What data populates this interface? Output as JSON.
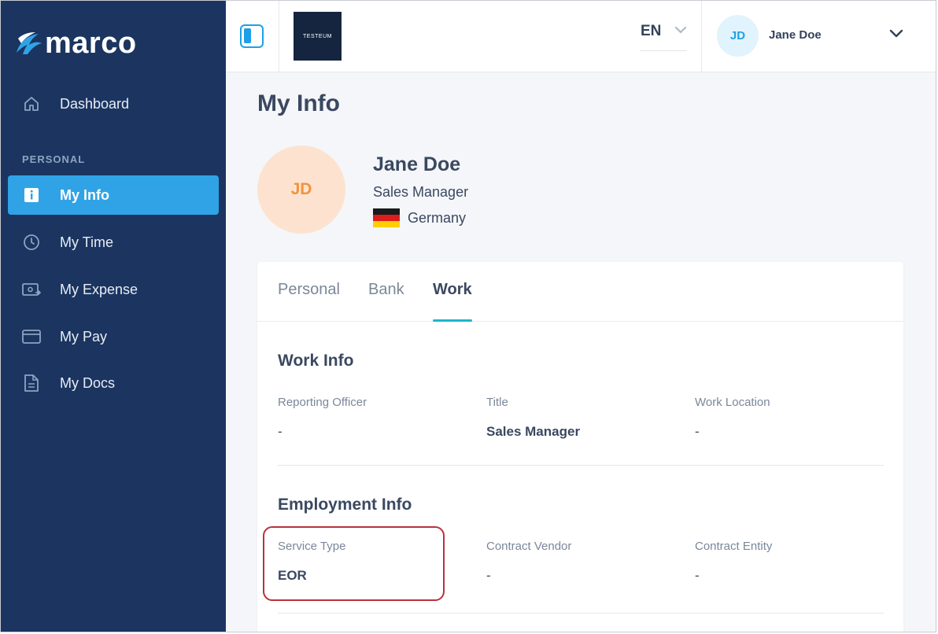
{
  "brand": {
    "name": "marco"
  },
  "sidebar": {
    "dashboard_label": "Dashboard",
    "section_label": "PERSONAL",
    "items": [
      {
        "label": "My Info",
        "icon": "info-icon",
        "active": true
      },
      {
        "label": "My Time",
        "icon": "clock-icon",
        "active": false
      },
      {
        "label": "My Expense",
        "icon": "expense-icon",
        "active": false
      },
      {
        "label": "My Pay",
        "icon": "card-icon",
        "active": false
      },
      {
        "label": "My Docs",
        "icon": "document-icon",
        "active": false
      }
    ]
  },
  "topbar": {
    "company_logo_text": "TESTEUM",
    "language": "EN",
    "user": {
      "initials": "JD",
      "name": "Jane Doe"
    }
  },
  "page": {
    "title": "My Info"
  },
  "profile": {
    "initials": "JD",
    "name": "Jane Doe",
    "job_title": "Sales Manager",
    "country": "Germany"
  },
  "tabs": [
    "Personal",
    "Bank",
    "Work"
  ],
  "active_tab": "Work",
  "work_info": {
    "title": "Work Info",
    "fields": [
      {
        "label": "Reporting Officer",
        "value": "-"
      },
      {
        "label": "Title",
        "value": "Sales Manager"
      },
      {
        "label": "Work Location",
        "value": "-"
      }
    ]
  },
  "employment_info": {
    "title": "Employment Info",
    "fields": [
      {
        "label": "Service Type",
        "value": "EOR"
      },
      {
        "label": "Contract Vendor",
        "value": "-"
      },
      {
        "label": "Contract Entity",
        "value": "-"
      }
    ]
  },
  "colors": {
    "sidebar_bg": "#1b3560",
    "accent": "#2fa3e6",
    "tab_underline": "#1cb7c9",
    "highlight_border": "#b8323c"
  }
}
